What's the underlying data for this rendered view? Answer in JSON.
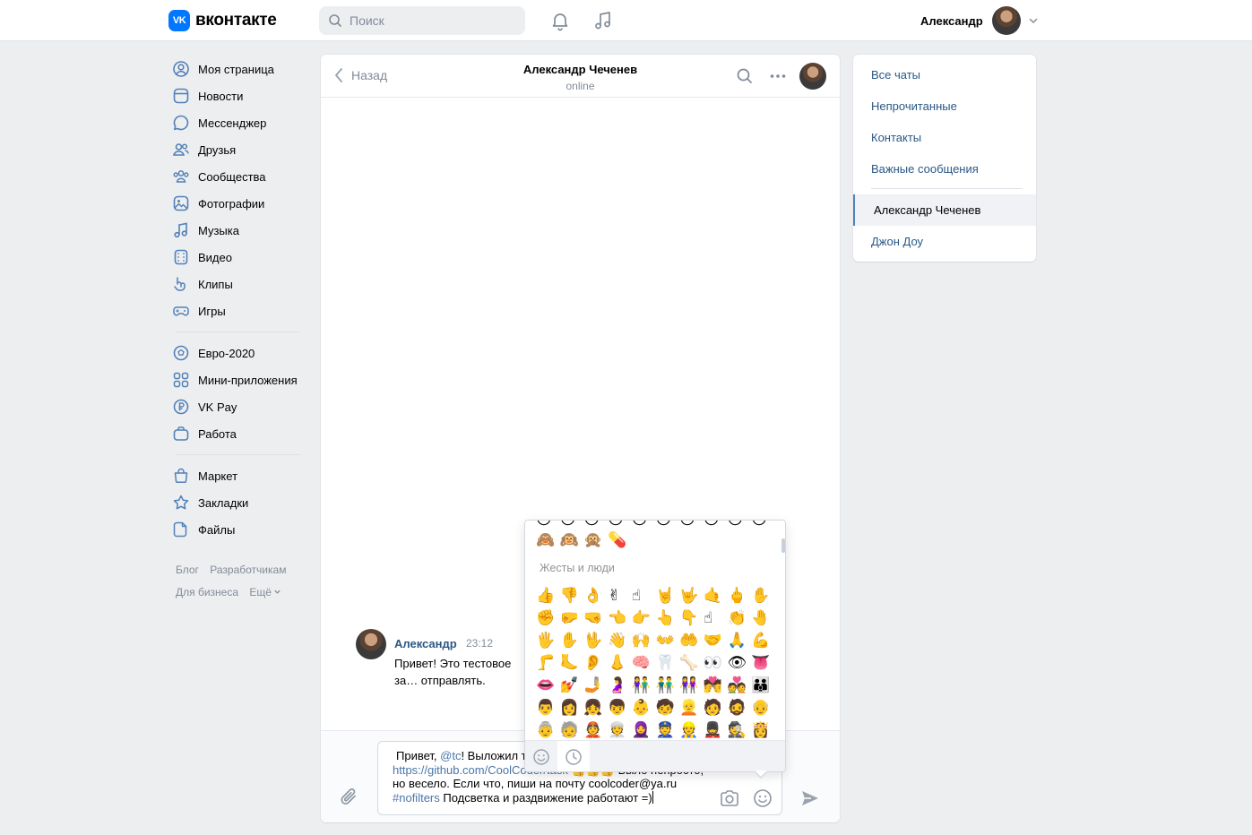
{
  "header": {
    "logo_mark": "VK",
    "logo_text": "вконтакте",
    "search_placeholder": "Поиск",
    "user_name": "Александр"
  },
  "nav": {
    "group1": [
      {
        "label": "Моя страница",
        "icon": "profile-icon"
      },
      {
        "label": "Новости",
        "icon": "news-icon"
      },
      {
        "label": "Мессенджер",
        "icon": "messenger-icon"
      },
      {
        "label": "Друзья",
        "icon": "friends-icon"
      },
      {
        "label": "Сообщества",
        "icon": "communities-icon"
      },
      {
        "label": "Фотографии",
        "icon": "photos-icon"
      },
      {
        "label": "Музыка",
        "icon": "music-icon"
      },
      {
        "label": "Видео",
        "icon": "video-icon"
      },
      {
        "label": "Клипы",
        "icon": "clips-icon"
      },
      {
        "label": "Игры",
        "icon": "games-icon"
      }
    ],
    "group2": [
      {
        "label": "Евро-2020",
        "icon": "football-icon"
      },
      {
        "label": "Мини-приложения",
        "icon": "miniapps-icon"
      },
      {
        "label": "VK Pay",
        "icon": "vkpay-icon"
      },
      {
        "label": "Работа",
        "icon": "work-icon"
      }
    ],
    "group3": [
      {
        "label": "Маркет",
        "icon": "market-icon"
      },
      {
        "label": "Закладки",
        "icon": "bookmarks-icon"
      },
      {
        "label": "Файлы",
        "icon": "files-icon"
      }
    ],
    "footer": {
      "blog": "Блог",
      "developers": "Разработчикам",
      "business": "Для бизнеса",
      "more": "Ещё"
    }
  },
  "chat": {
    "back_label": "Назад",
    "title": "Александр Чеченев",
    "status": "online",
    "message": {
      "author": "Александр",
      "time": "23:12",
      "text": "Привет! Это тестовое за… отправлять."
    },
    "composer": {
      "l1a": "Привет, ",
      "l1_mention": "@tc",
      "l1b": "! Выложил т",
      "l2_link": "https://github.com/CoolCoder/task",
      "l2b": " 👍👍👍 Было непросто,",
      "l3": "но весело. Если что, пиши на почту coolcoder@ya.ru",
      "l4_tag": "#nofilters",
      "l4b": " Подсветка и раздвижение работают =)"
    }
  },
  "emoji_panel": {
    "category": "Жесты и люди",
    "top_partial": [
      "😶",
      "😶",
      "😶",
      "😶",
      "😶",
      "😶",
      "😶",
      "😶",
      "😶",
      "😶"
    ],
    "monkeys": [
      "🙈",
      "🙉",
      "🙊",
      "💊"
    ],
    "rows": [
      [
        "👍",
        "👎",
        "👌",
        "✌",
        "☝",
        "🤘",
        "🤟",
        "🤙",
        "🖕",
        "✋"
      ],
      [
        "✊",
        "🤛",
        "🤜",
        "👈",
        "👉",
        "👆",
        "👇",
        "☝",
        "👏",
        "🤚"
      ],
      [
        "🖐",
        "✋",
        "🖖",
        "👋",
        "🙌",
        "👐",
        "🤲",
        "🤝",
        "🙏",
        "💪"
      ],
      [
        "🦵",
        "🦶",
        "👂",
        "👃",
        "🧠",
        "🦷",
        "🦴",
        "👀",
        "👁",
        "👅"
      ],
      [
        "👄",
        "💅",
        "🤳",
        "🤰",
        "👫",
        "👬",
        "👭",
        "💏",
        "💑",
        "👪"
      ],
      [
        "👨",
        "👩",
        "👧",
        "👦",
        "👶",
        "🧒",
        "👱",
        "🧑",
        "🧔",
        "👴"
      ],
      [
        "👵",
        "🧓",
        "👲",
        "👳",
        "🧕",
        "👮",
        "👷",
        "💂",
        "🕵",
        "👸"
      ]
    ]
  },
  "right_menu": {
    "items": [
      "Все чаты",
      "Непрочитанные",
      "Контакты",
      "Важные сообщения"
    ],
    "chats": [
      "Александр Чеченев",
      "Джон Доу"
    ]
  },
  "colors": {
    "accent": "#0077ff",
    "link": "#2a5885",
    "highlight": "#4a76a8",
    "background": "#edeef0"
  }
}
